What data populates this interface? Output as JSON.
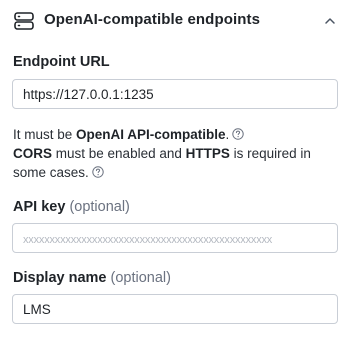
{
  "header": {
    "title": "OpenAI-compatible endpoints",
    "icon": "server-icon",
    "toggle_icon": "chevron-up-icon"
  },
  "endpoint": {
    "label": "Endpoint URL",
    "value": "https://127.0.0.1:1235"
  },
  "help": {
    "line1_prefix": "It must be ",
    "line1_bold": "OpenAI API-compatible",
    "line1_suffix": ".",
    "line2_bold1": "CORS",
    "line2_mid": " must be enabled and ",
    "line2_bold2": "HTTPS",
    "line2_suffix": " is required in some cases.",
    "icon": "question-circle-icon"
  },
  "api_key": {
    "label": "API key",
    "optional": "(optional)",
    "placeholder": "xxxxxxxxxxxxxxxxxxxxxxxxxxxxxxxxxxxxxxxxxxxxxxx",
    "value": ""
  },
  "display_name": {
    "label": "Display name",
    "optional": "(optional)",
    "value": "LMS"
  },
  "colors": {
    "text": "#1f2328",
    "muted": "#6b7280",
    "border": "#c9ced6",
    "placeholder": "#b4b9c1"
  }
}
